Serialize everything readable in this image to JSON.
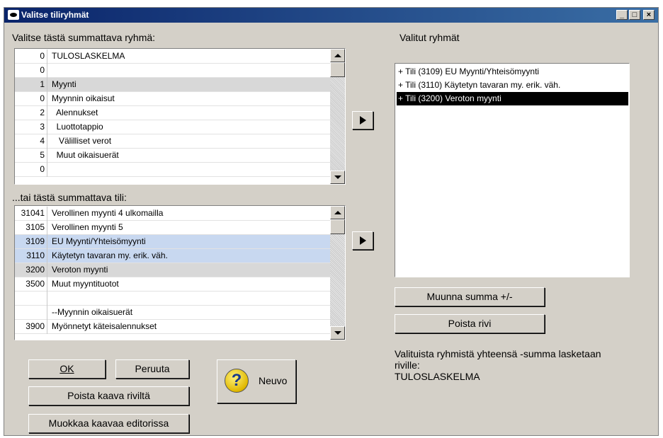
{
  "window": {
    "title": "Valitse tiliryhmät"
  },
  "labels": {
    "group_select": "Valitse tästä summattava ryhmä:",
    "account_select": "...tai tästä summattava tili:",
    "selected_groups": "Valitut ryhmät",
    "sum_info": "Valituista ryhmistä yhteensä -summa lasketaan riville:",
    "target_row": "TULOSLASKELMA"
  },
  "groups": [
    {
      "num": "0",
      "text": "TULOSLASKELMA"
    },
    {
      "num": "0",
      "text": ""
    },
    {
      "num": "1",
      "text": "Myynti"
    },
    {
      "num": "0",
      "text": "Myynnin oikaisut"
    },
    {
      "num": "2",
      "text": "  Alennukset"
    },
    {
      "num": "3",
      "text": "  Luottotappio"
    },
    {
      "num": "4",
      "text": "   Välilliset verot"
    },
    {
      "num": "5",
      "text": "  Muut oikaisuerät"
    },
    {
      "num": "0",
      "text": ""
    }
  ],
  "accounts": [
    {
      "num": "31041",
      "text": "Verollinen myynti 4 ulkomailla"
    },
    {
      "num": "3105",
      "text": "Verollinen myynti 5"
    },
    {
      "num": "3109",
      "text": "EU Myynti/Yhteisömyynti"
    },
    {
      "num": "3110",
      "text": "Käytetyn tavaran my. erik. väh."
    },
    {
      "num": "3200",
      "text": "Veroton myynti"
    },
    {
      "num": "3500",
      "text": "Muut myyntituotot"
    },
    {
      "num": "",
      "text": ""
    },
    {
      "num": "",
      "text": "--Myynnin oikaisuerät"
    },
    {
      "num": "3900",
      "text": "Myönnetyt käteisalennukset"
    }
  ],
  "selected": [
    "+ Tili (3109) EU Myynti/Yhteisömyynti",
    "+ Tili (3110) Käytetyn tavaran my. erik. väh.",
    "+ Tili (3200) Veroton myynti"
  ],
  "buttons": {
    "invert": "Muunna summa +/-",
    "delete_row": "Poista rivi",
    "ok": "OK",
    "cancel": "Peruuta",
    "help": "Neuvo",
    "remove_formula": "Poista kaava riviltä",
    "edit_formula": "Muokkaa kaavaa editorissa"
  }
}
